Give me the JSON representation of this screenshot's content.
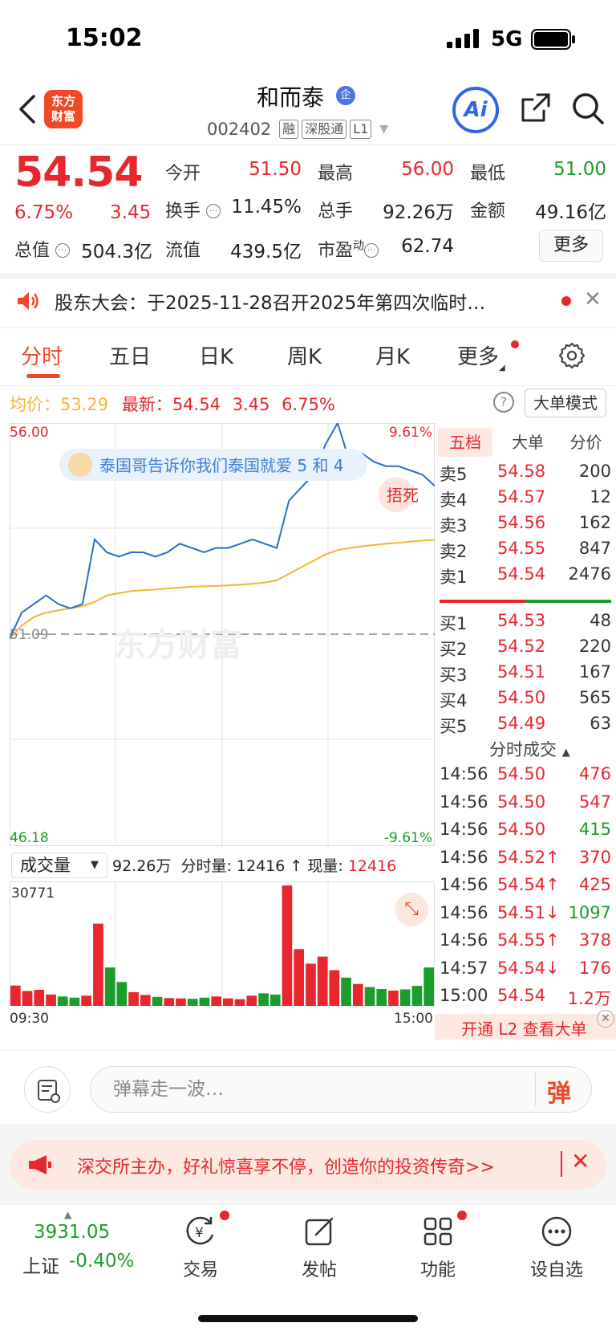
{
  "status_bar": {
    "time": "15:02",
    "network": "5G"
  },
  "header": {
    "stock_name": "和而泰",
    "name_badge": "企",
    "stock_code": "002402",
    "tags": [
      "融",
      "深股通",
      "L1"
    ],
    "logo_text": [
      "东方",
      "财富"
    ],
    "ai_label": "Ai"
  },
  "quote": {
    "price": "54.54",
    "change_pct": "6.75%",
    "change_amt": "3.45",
    "open_label": "今开",
    "open": "51.50",
    "high_label": "最高",
    "high": "56.00",
    "low_label": "最低",
    "low": "51.00",
    "turnover_label": "换手",
    "turnover": "11.45%",
    "volume_label": "总手",
    "volume": "92.26万",
    "amount_label": "金额",
    "amount": "49.16亿",
    "cap_total_label": "总值",
    "cap_total": "504.3亿",
    "cap_float_label": "流值",
    "cap_float": "439.5亿",
    "pe_label": "市盈",
    "pe_sup": "动",
    "pe": "62.74",
    "more_label": "更多"
  },
  "notice": {
    "text": "股东大会：于2025-11-28召开2025年第四次临时…"
  },
  "tabs": [
    "分时",
    "五日",
    "日K",
    "周K",
    "月K",
    "更多"
  ],
  "intraday": {
    "avg_label": "均价：",
    "avg": "53.29",
    "latest_label": "最新：",
    "latest": "54.54",
    "latest_change": "3.45",
    "latest_pct": "6.75%",
    "help": "?",
    "big_order_mode": "大单模式"
  },
  "chart": {
    "y_top": "56.00",
    "y_mid": "51.09",
    "y_bottom": "46.18",
    "pct_top": "9.61%",
    "pct_bottom": "-9.61%",
    "x_start": "09:30",
    "x_end": "15:00",
    "danmaku": "泰国哥告诉你我们泰国就爱 5 和 4",
    "floating_tag": "捂死",
    "watermark": "东方财富",
    "vol_max": "30771"
  },
  "chart_data": {
    "type": "line",
    "series": [
      {
        "name": "价格",
        "values": [
          51.0,
          51.6,
          51.8,
          52.0,
          51.8,
          51.7,
          51.8,
          53.3,
          53.0,
          52.9,
          53.0,
          53.0,
          52.9,
          53.0,
          53.2,
          53.1,
          53.0,
          53.1,
          53.1,
          53.2,
          53.3,
          53.2,
          53.1,
          54.2,
          54.5,
          54.8,
          55.5,
          56.0,
          55.1,
          55.3,
          55.1,
          55.0,
          55.0,
          54.9,
          54.8,
          54.54
        ]
      },
      {
        "name": "均价",
        "values": [
          51.0,
          51.3,
          51.5,
          51.6,
          51.65,
          51.7,
          51.75,
          51.85,
          52.0,
          52.05,
          52.1,
          52.12,
          52.14,
          52.16,
          52.18,
          52.2,
          52.21,
          52.22,
          52.23,
          52.25,
          52.27,
          52.3,
          52.35,
          52.5,
          52.65,
          52.8,
          52.95,
          53.05,
          53.1,
          53.14,
          53.17,
          53.2,
          53.22,
          53.25,
          53.27,
          53.29
        ]
      }
    ],
    "volume": [
      5200,
      3800,
      4100,
      2900,
      2400,
      2100,
      2600,
      21000,
      9800,
      6100,
      3500,
      2800,
      2300,
      2000,
      1900,
      1800,
      2100,
      2400,
      1900,
      1700,
      2600,
      3200,
      2900,
      30771,
      14500,
      10800,
      12600,
      9100,
      7200,
      5600,
      4800,
      4300,
      3900,
      4200,
      5100,
      9800
    ],
    "ylim": [
      46.18,
      56.0
    ],
    "vol_ylim": [
      0,
      30771
    ]
  },
  "order_book": {
    "tabs": [
      "五档",
      "大单",
      "分价"
    ],
    "asks": [
      {
        "label": "卖5",
        "price": "54.58",
        "vol": "200"
      },
      {
        "label": "卖4",
        "price": "54.57",
        "vol": "12"
      },
      {
        "label": "卖3",
        "price": "54.56",
        "vol": "162"
      },
      {
        "label": "卖2",
        "price": "54.55",
        "vol": "847"
      },
      {
        "label": "卖1",
        "price": "54.54",
        "vol": "2476"
      }
    ],
    "bids": [
      {
        "label": "买1",
        "price": "54.53",
        "vol": "48"
      },
      {
        "label": "买2",
        "price": "54.52",
        "vol": "220"
      },
      {
        "label": "买3",
        "price": "54.51",
        "vol": "167"
      },
      {
        "label": "买4",
        "price": "54.50",
        "vol": "565"
      },
      {
        "label": "买5",
        "price": "54.49",
        "vol": "63"
      }
    ],
    "trades_header": "分时成交",
    "trades": [
      {
        "time": "14:56",
        "price": "54.50",
        "vol": "476",
        "dir": "up"
      },
      {
        "time": "14:56",
        "price": "54.50",
        "vol": "547",
        "dir": "up"
      },
      {
        "time": "14:56",
        "price": "54.50",
        "vol": "415",
        "dir": "down"
      },
      {
        "time": "14:56",
        "price": "54.52↑",
        "vol": "370",
        "dir": "up"
      },
      {
        "time": "14:56",
        "price": "54.54↑",
        "vol": "425",
        "dir": "up"
      },
      {
        "time": "14:56",
        "price": "54.51↓",
        "vol": "1097",
        "dir": "down"
      },
      {
        "time": "14:56",
        "price": "54.55↑",
        "vol": "378",
        "dir": "up"
      },
      {
        "time": "14:57",
        "price": "54.54↓",
        "vol": "176",
        "dir": "up"
      },
      {
        "time": "15:00",
        "price": "54.54",
        "vol": "1.2万",
        "dir": "up"
      }
    ],
    "l2_banner": "开通 L2 查看大单"
  },
  "volume_bar": {
    "select": "成交量",
    "total": "92.26万",
    "period_label": "分时量:",
    "period": "12416",
    "now_label": "现量:",
    "now": "12416"
  },
  "comment": {
    "placeholder": "弹幕走一波…",
    "danmu_label": "弹"
  },
  "promo": {
    "text": "深交所主办，好礼惊喜享不停，创造你的投资传奇>>"
  },
  "bottom_nav": {
    "index_value": "3931.05",
    "index_name": "上证",
    "index_change": "-0.40%",
    "items": [
      "交易",
      "发帖",
      "功能",
      "设自选"
    ]
  },
  "colors": {
    "up": "#e8262e",
    "down": "#1a9d2b",
    "brand": "#ef4a25",
    "line": "#2a6fc5",
    "avg": "#f5b335"
  }
}
